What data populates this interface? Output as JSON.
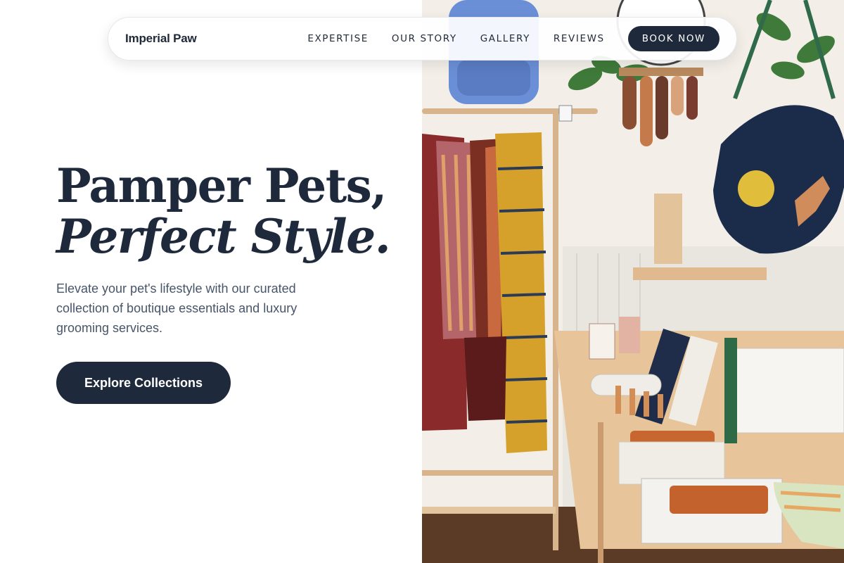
{
  "nav": {
    "brand": "Imperial Paw",
    "links": [
      "EXPERTISE",
      "OUR STORY",
      "GALLERY",
      "REVIEWS"
    ],
    "cta": "BOOK NOW"
  },
  "hero": {
    "title_line1": "Pamper Pets,",
    "title_line2": "Perfect Style.",
    "subtitle": "Elevate your pet's lifestyle with our curated collection of boutique essentials and luxury grooming services.",
    "cta": "Explore Collections"
  },
  "colors": {
    "primary_dark": "#1e293b",
    "text_muted": "#475569",
    "background": "#ffffff"
  },
  "image": {
    "subject": "boutique-shop-interior-photo"
  }
}
